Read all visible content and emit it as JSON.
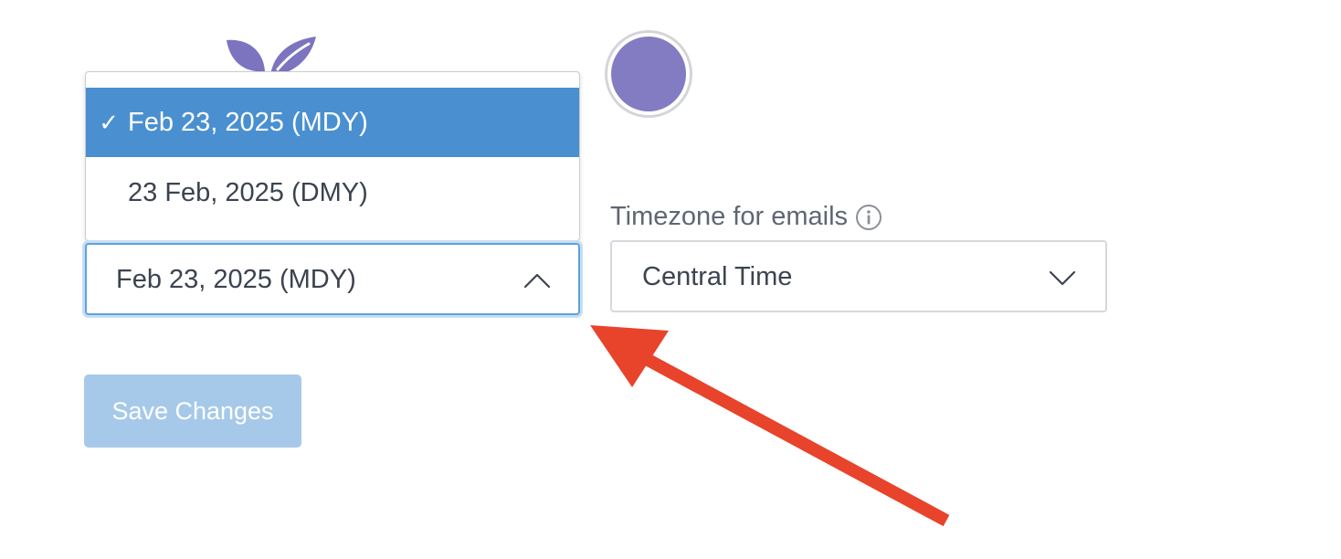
{
  "profile": {
    "avatar_color": "#837cc2",
    "logo_icon": "leaf-logo-icon",
    "logo_color": "#7c74bf"
  },
  "date_format": {
    "selected_value": "Feb 23, 2025 (MDY)",
    "expanded": true,
    "options": [
      {
        "label": "Feb 23, 2025 (MDY)",
        "selected": true,
        "mark": "✓"
      },
      {
        "label": "23 Feb, 2025 (DMY)",
        "selected": false,
        "mark": ""
      }
    ],
    "chevron_icon": "chevron-up-icon"
  },
  "timezone": {
    "label": "Timezone for emails",
    "info_icon": "info-icon",
    "selected_value": "Central Time",
    "chevron_icon": "chevron-down-icon"
  },
  "actions": {
    "save_label": "Save Changes"
  },
  "annotation": {
    "arrow_color": "#e8432b",
    "arrow_icon": "red-arrow-annotation"
  },
  "colors": {
    "accent": "#4a90d0",
    "focus_ring": "#5fa2dd",
    "button_disabled": "#a6c9e9"
  }
}
